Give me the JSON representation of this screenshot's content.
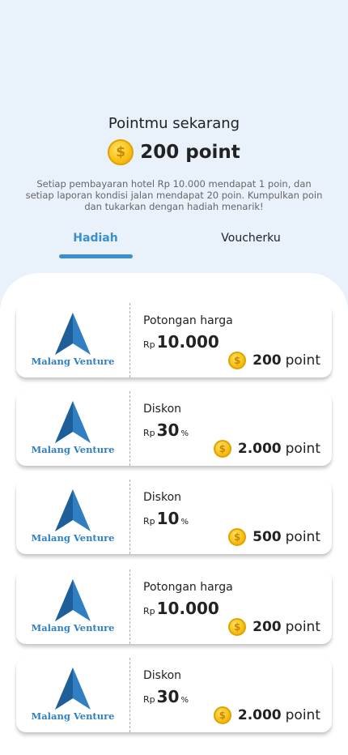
{
  "header": {
    "title": "Pointmu sekarang",
    "points": "200 point",
    "description": "Setiap pembayaran hotel Rp 10.000 mendapat 1 poin, dan setiap laporan kondisi jalan mendapat 20 poin. Kumpulkan poin dan tukarkan dengan hadiah menarik!"
  },
  "tabs": {
    "active": "Hadiah",
    "items": [
      "Hadiah",
      "Voucherku"
    ]
  },
  "colors": {
    "accent": "#3a8fd0",
    "background": "#e9f1fa",
    "coin": "#f8c21a"
  },
  "rewards": [
    {
      "brand": "Malang Venture",
      "type": "Potongan harga",
      "currency": "Rp",
      "amount": "10.000",
      "suffix": "",
      "cost": "200",
      "unit": "point"
    },
    {
      "brand": "Malang Venture",
      "type": "Diskon",
      "currency": "Rp",
      "amount": "30",
      "suffix": "%",
      "cost": "2.000",
      "unit": "point"
    },
    {
      "brand": "Malang Venture",
      "type": "Diskon",
      "currency": "Rp",
      "amount": "10",
      "suffix": "%",
      "cost": "500",
      "unit": "point"
    },
    {
      "brand": "Malang Venture",
      "type": "Potongan harga",
      "currency": "Rp",
      "amount": "10.000",
      "suffix": "",
      "cost": "200",
      "unit": "point"
    },
    {
      "brand": "Malang Venture",
      "type": "Diskon",
      "currency": "Rp",
      "amount": "30",
      "suffix": "%",
      "cost": "2.000",
      "unit": "point"
    }
  ]
}
